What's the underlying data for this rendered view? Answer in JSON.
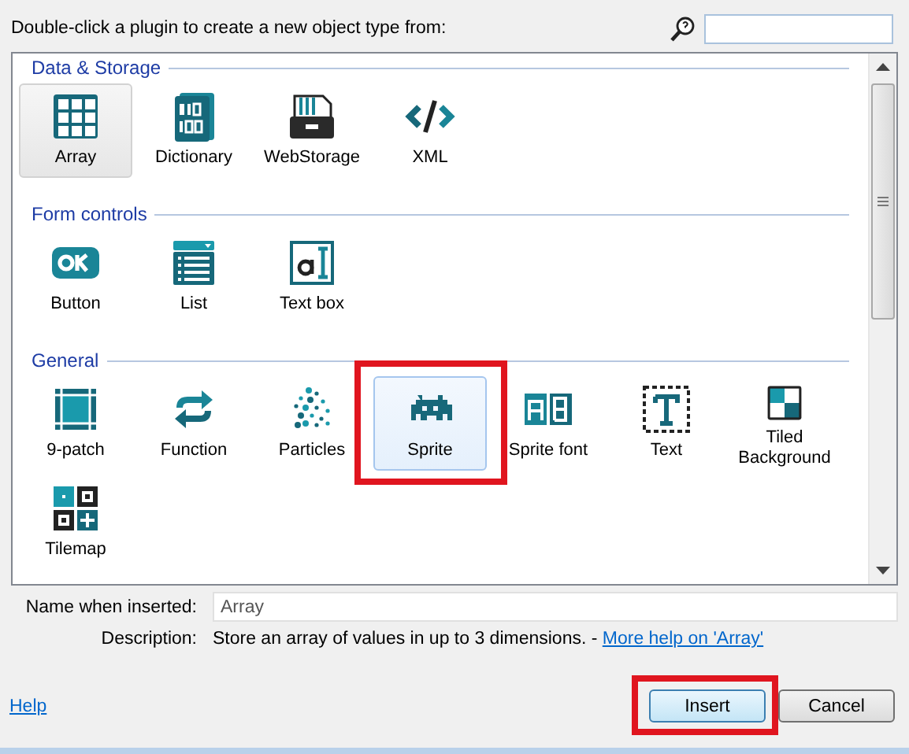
{
  "prompt": "Double-click a plugin to create a new object type from:",
  "groups": [
    {
      "title": "Data & Storage",
      "items": [
        {
          "label": "Array",
          "kind": "grid",
          "selected": false,
          "hovered": true,
          "annotated": false
        },
        {
          "label": "Dictionary",
          "kind": "binary",
          "selected": false,
          "hovered": false,
          "annotated": false
        },
        {
          "label": "WebStorage",
          "kind": "storage",
          "selected": false,
          "hovered": false,
          "annotated": false
        },
        {
          "label": "XML",
          "kind": "code",
          "selected": false,
          "hovered": false,
          "annotated": false
        }
      ]
    },
    {
      "title": "Form controls",
      "items": [
        {
          "label": "Button",
          "kind": "ok",
          "selected": false,
          "hovered": false,
          "annotated": false
        },
        {
          "label": "List",
          "kind": "list",
          "selected": false,
          "hovered": false,
          "annotated": false
        },
        {
          "label": "Text box",
          "kind": "textbox",
          "selected": false,
          "hovered": false,
          "annotated": false
        }
      ]
    },
    {
      "title": "General",
      "items": [
        {
          "label": "9-patch",
          "kind": "patch",
          "selected": false,
          "hovered": false,
          "annotated": false
        },
        {
          "label": "Function",
          "kind": "cycle",
          "selected": false,
          "hovered": false,
          "annotated": false
        },
        {
          "label": "Particles",
          "kind": "dots",
          "selected": false,
          "hovered": false,
          "annotated": false
        },
        {
          "label": "Sprite",
          "kind": "invader",
          "selected": true,
          "hovered": false,
          "annotated": true
        },
        {
          "label": "Sprite font",
          "kind": "letters",
          "selected": false,
          "hovered": false,
          "annotated": false
        },
        {
          "label": "Text",
          "kind": "text",
          "selected": false,
          "hovered": false,
          "annotated": false
        },
        {
          "label": "Tiled Background",
          "kind": "tiles",
          "selected": false,
          "hovered": false,
          "annotated": false
        },
        {
          "label": "Tilemap",
          "kind": "tilemap",
          "selected": false,
          "hovered": false,
          "annotated": false
        }
      ]
    }
  ],
  "name_field": {
    "label": "Name when inserted:",
    "value": "Array"
  },
  "description": {
    "label": "Description:",
    "text": "Store an array of values in up to 3 dimensions. - ",
    "link": "More help on 'Array'"
  },
  "help_link": "Help",
  "buttons": [
    {
      "label": "Insert",
      "default": true,
      "annotated": true
    },
    {
      "label": "Cancel",
      "default": false,
      "annotated": false
    }
  ]
}
